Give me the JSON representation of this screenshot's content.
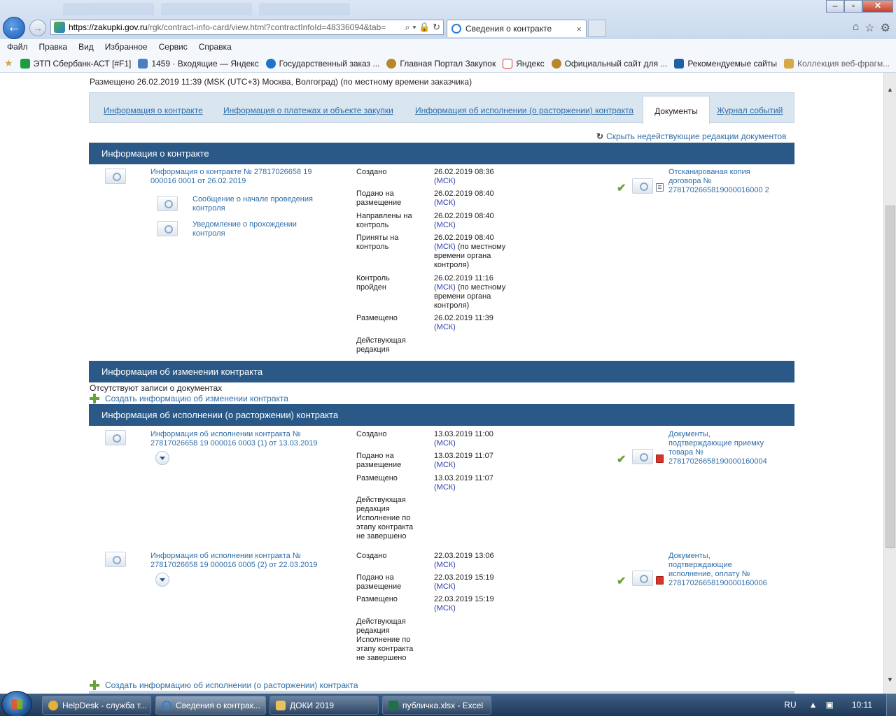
{
  "browser": {
    "url_host": "https://zakupki.gov.ru",
    "url_path": "/rgk/contract-info-card/view.html?contractInfoId=48336094&tab=",
    "addr_tools": "⌕ ▾ 🔒 ↻",
    "tab_title": "Сведения о контракте",
    "tab_close": "×",
    "window_buttons": [
      "–",
      "▫",
      "✕"
    ],
    "right_icons": [
      "⌂",
      "☆",
      "⚙"
    ]
  },
  "menu": [
    "Файл",
    "Правка",
    "Вид",
    "Избранное",
    "Сервис",
    "Справка"
  ],
  "favorites": [
    {
      "label": "ЭТП Сбербанк-АСТ [#F1]",
      "icon": "sberbank-icon",
      "color": "#1f9c3d"
    },
    {
      "label": "1459 · Входящие — Яндекс",
      "icon": "mail-icon",
      "color": "#4a7fc1"
    },
    {
      "label": "Государственный заказ ...",
      "icon": "globe-icon",
      "color": "#1d74c8"
    },
    {
      "label": "Главная Портал Закупок",
      "icon": "emblem-icon",
      "color": "#b8862b"
    },
    {
      "label": "Яндекс",
      "icon": "yandex-icon",
      "color": "#d9342b"
    },
    {
      "label": "Официальный сайт для ...",
      "icon": "emblem-icon",
      "color": "#b8862b"
    },
    {
      "label": "Рекомендуемые сайты",
      "icon": "bing-icon",
      "color": "#1e5fa6"
    },
    {
      "label": "Коллекция веб-фрагм...",
      "icon": "webslice-icon",
      "color": "#d6a84a"
    }
  ],
  "page": {
    "posted": "Размещено 26.02.2019 11:39 (MSK (UTC+3) Москва, Волгоград) (по местному времени заказчика)",
    "tabs": [
      "Информация о контракте",
      "Информация о платежах и объекте закупки",
      "Информация об исполнении (о расторжении) контракта",
      "Документы",
      "Журнал событий"
    ],
    "hide_link": "Скрыть недействующие редакции документов",
    "section1": {
      "title": "Информация о контракте",
      "doc_title": "Информация о контракте № 27817026658 19 000016 0001 от 26.02.2019",
      "sub_docs": [
        "Сообщение о начале проведения контроля",
        "Уведомление о прохождении контроля"
      ],
      "rows": [
        {
          "label": "Создано",
          "date": "26.02.2019 08:36",
          "msk": "(МСК)",
          "note": ""
        },
        {
          "label": "Подано на размещение",
          "date": "26.02.2019 08:40",
          "msk": "(МСК)",
          "note": ""
        },
        {
          "label": "Направлены на контроль",
          "date": "26.02.2019 08:40",
          "msk": "(МСК)",
          "note": ""
        },
        {
          "label": "Приняты на контроль",
          "date": "26.02.2019 08:40",
          "msk": "(МСК)",
          "note": " (по местному времени органа контроля)"
        },
        {
          "label": "Контроль пройден",
          "date": "26.02.2019 11:16",
          "msk": "(МСК)",
          "note": " (по местному времени органа контроля)"
        },
        {
          "label": "Размещено",
          "date": "26.02.2019 11:39",
          "msk": "(МСК)",
          "note": ""
        },
        {
          "label": "Действующая редакция",
          "date": "",
          "msk": "",
          "note": ""
        }
      ],
      "attachment": "Отсканированая копия договора № 2781702665819000016000 2"
    },
    "section2": {
      "title": "Информация об изменении контракта",
      "empty": "Отсутствуют записи о документах",
      "create": "Создать информацию об изменении контракта"
    },
    "section3": {
      "title": "Информация об исполнении (о расторжении) контракта",
      "items": [
        {
          "doc_title": "Информация об исполнении контракта № 27817026658 19 000016 0003 (1) от 13.03.2019",
          "rows": [
            {
              "label": "Создано",
              "date": "13.03.2019 11:00",
              "msk": "(МСК)"
            },
            {
              "label": "Подано на размещение",
              "date": "13.03.2019 11:07",
              "msk": "(МСК)"
            },
            {
              "label": "Размещено",
              "date": "13.03.2019 11:07",
              "msk": "(МСК)"
            },
            {
              "label": "Действующая редакция Исполнение по этапу контракта не завершено",
              "date": "",
              "msk": ""
            }
          ],
          "attachment": "Документы, подтверждающие приемку товара № 27817026658190000160004"
        },
        {
          "doc_title": "Информация об исполнении контракта № 27817026658 19 000016 0005 (2) от 22.03.2019",
          "rows": [
            {
              "label": "Создано",
              "date": "22.03.2019 13:06",
              "msk": "(МСК)"
            },
            {
              "label": "Подано на размещение",
              "date": "22.03.2019 15:19",
              "msk": "(МСК)"
            },
            {
              "label": "Размещено",
              "date": "22.03.2019 15:19",
              "msk": "(МСК)"
            },
            {
              "label": "Действующая редакция Исполнение по этапу контракта не завершено",
              "date": "",
              "msk": ""
            }
          ],
          "attachment": "Документы, подтверждающие исполнение, оплату № 27817026658190000160006"
        }
      ],
      "create": "Создать информацию об исполнении (о расторжении) контракта"
    }
  },
  "taskbar": {
    "items": [
      {
        "label": "HelpDesk - служба т...",
        "icon": "chrome-icon",
        "color": "#e2b23a"
      },
      {
        "label": "Сведения о контрак...",
        "icon": "ie-icon",
        "color": "#2d7fd1"
      },
      {
        "label": "ДОКИ 2019",
        "icon": "folder-icon",
        "color": "#e8c25a"
      },
      {
        "label": "публичка.xlsx - Excel",
        "icon": "excel-icon",
        "color": "#1e7145"
      }
    ],
    "lang": "RU",
    "time": "10:11"
  },
  "colors": {
    "section_bar": "#2b5987",
    "link": "#2f6ea9",
    "tab_strip": "#d9e5ef",
    "check": "#6aa23a"
  }
}
